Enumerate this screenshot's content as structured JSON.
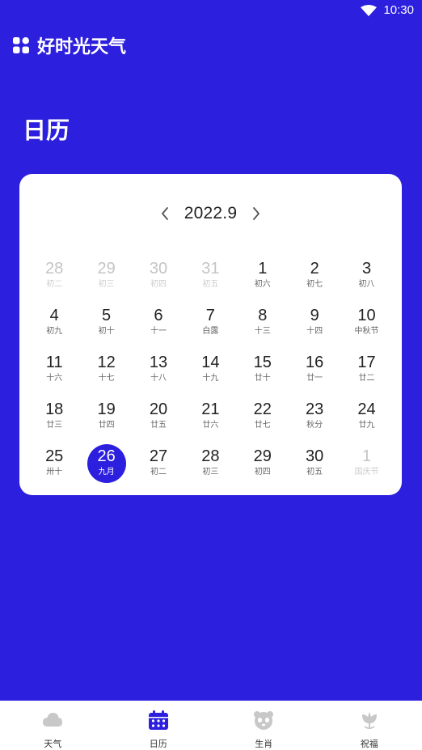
{
  "status": {
    "time": "10:30"
  },
  "header": {
    "app_title": "好时光天气"
  },
  "page": {
    "title": "日历"
  },
  "calendar": {
    "month_label": "2022.9",
    "days": [
      {
        "num": "28",
        "lunar": "初二",
        "other": true
      },
      {
        "num": "29",
        "lunar": "初三",
        "other": true
      },
      {
        "num": "30",
        "lunar": "初四",
        "other": true
      },
      {
        "num": "31",
        "lunar": "初五",
        "other": true
      },
      {
        "num": "1",
        "lunar": "初六"
      },
      {
        "num": "2",
        "lunar": "初七"
      },
      {
        "num": "3",
        "lunar": "初八"
      },
      {
        "num": "4",
        "lunar": "初九"
      },
      {
        "num": "5",
        "lunar": "初十"
      },
      {
        "num": "6",
        "lunar": "十一"
      },
      {
        "num": "7",
        "lunar": "白露"
      },
      {
        "num": "8",
        "lunar": "十三"
      },
      {
        "num": "9",
        "lunar": "十四"
      },
      {
        "num": "10",
        "lunar": "中秋节"
      },
      {
        "num": "11",
        "lunar": "十六"
      },
      {
        "num": "12",
        "lunar": "十七"
      },
      {
        "num": "13",
        "lunar": "十八"
      },
      {
        "num": "14",
        "lunar": "十九"
      },
      {
        "num": "15",
        "lunar": "廿十"
      },
      {
        "num": "16",
        "lunar": "廿一"
      },
      {
        "num": "17",
        "lunar": "廿二"
      },
      {
        "num": "18",
        "lunar": "廿三"
      },
      {
        "num": "19",
        "lunar": "廿四"
      },
      {
        "num": "20",
        "lunar": "廿五"
      },
      {
        "num": "21",
        "lunar": "廿六"
      },
      {
        "num": "22",
        "lunar": "廿七"
      },
      {
        "num": "23",
        "lunar": "秋分"
      },
      {
        "num": "24",
        "lunar": "廿九"
      },
      {
        "num": "25",
        "lunar": "卅十"
      },
      {
        "num": "26",
        "lunar": "九月",
        "selected": true
      },
      {
        "num": "27",
        "lunar": "初二"
      },
      {
        "num": "28",
        "lunar": "初三"
      },
      {
        "num": "29",
        "lunar": "初四"
      },
      {
        "num": "30",
        "lunar": "初五"
      },
      {
        "num": "1",
        "lunar": "国庆节",
        "other": true
      }
    ]
  },
  "bottom_nav": {
    "tabs": [
      {
        "label": "天气",
        "icon": "cloud-icon",
        "active": false
      },
      {
        "label": "日历",
        "icon": "calendar-icon",
        "active": true
      },
      {
        "label": "生肖",
        "icon": "panda-icon",
        "active": false
      },
      {
        "label": "祝福",
        "icon": "flower-icon",
        "active": false
      }
    ]
  },
  "colors": {
    "primary": "#2d1fde",
    "card_bg": "#ffffff",
    "muted_day": "#c4c4c4",
    "inactive_icon": "#c8c8c8"
  }
}
